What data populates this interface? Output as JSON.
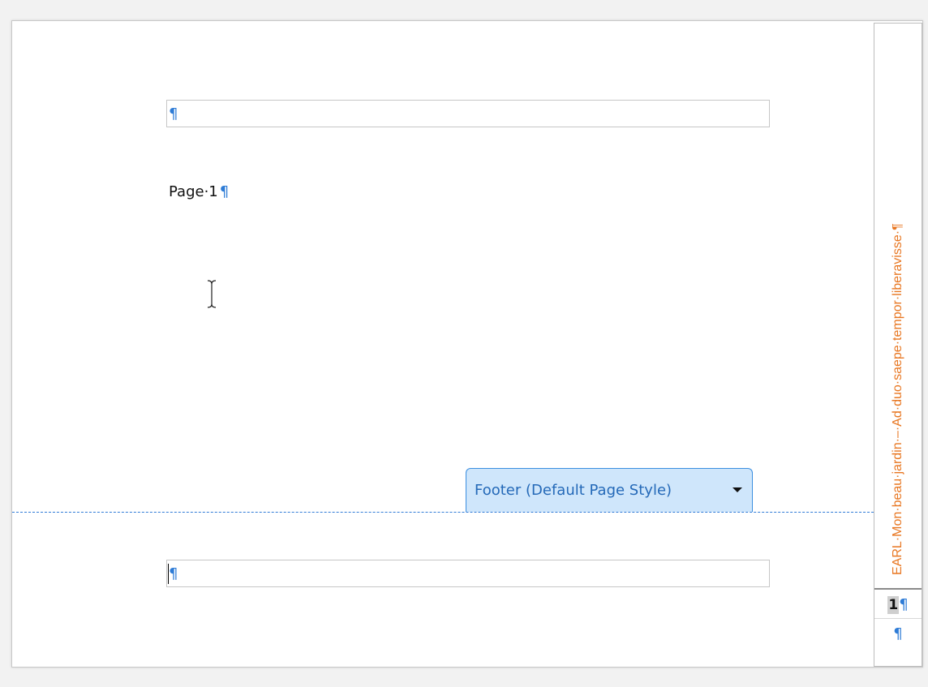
{
  "document": {
    "header_paragraph_mark": "¶",
    "body_text": "Page·1",
    "body_paragraph_mark": "¶",
    "footer_paragraph_mark": "¶"
  },
  "footer_tab": {
    "label": "Footer (Default Page Style)",
    "icon": "chevron-down-icon"
  },
  "side_frame": {
    "vertical_text": "EARL·Mon·beau·jardin·–·Ad·duo·saepe·tempor·liberavisse·¶",
    "page_number": "1",
    "page_number_mark": "¶",
    "empty_paragraph_mark": "¶"
  },
  "colors": {
    "paragraph_mark": "#2d7bd6",
    "vertical_text": "#e87722",
    "footer_tab_bg": "#cfe6fb",
    "footer_tab_border": "#3b8ee0",
    "divider": "#2f7ad6"
  }
}
